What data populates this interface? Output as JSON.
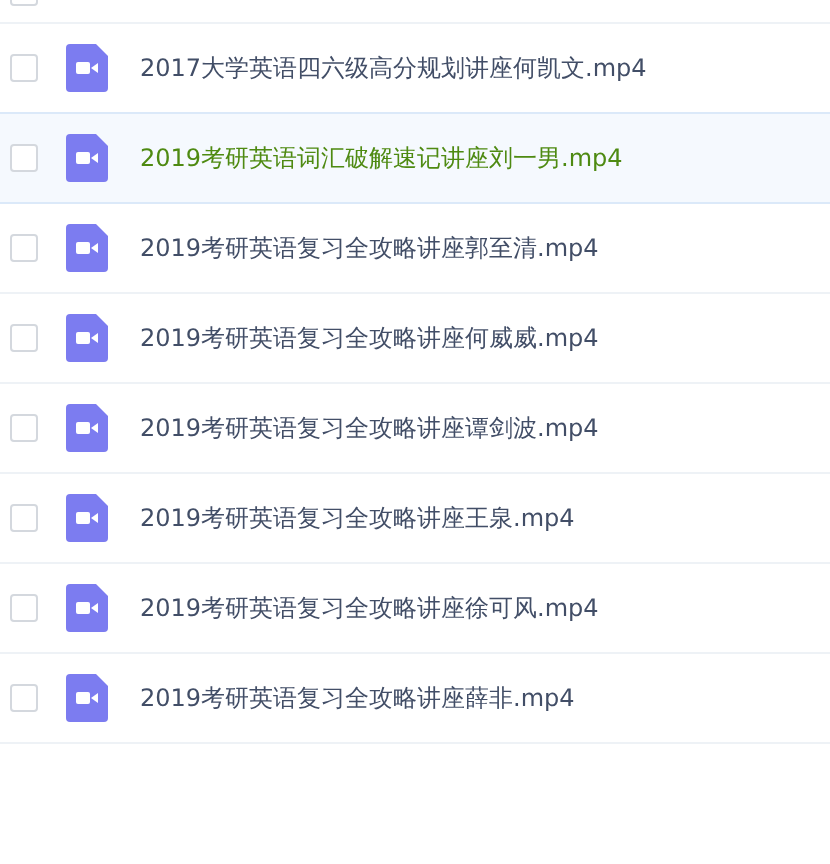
{
  "partial_row": {
    "checked": false
  },
  "files": [
    {
      "name": "2017大学英语四六级高分规划讲座何凯文.mp4",
      "selected": false,
      "checked": false
    },
    {
      "name": "2019考研英语词汇破解速记讲座刘一男.mp4",
      "selected": true,
      "checked": false
    },
    {
      "name": "2019考研英语复习全攻略讲座郭至清.mp4",
      "selected": false,
      "checked": false
    },
    {
      "name": "2019考研英语复习全攻略讲座何威威.mp4",
      "selected": false,
      "checked": false
    },
    {
      "name": "2019考研英语复习全攻略讲座谭剑波.mp4",
      "selected": false,
      "checked": false
    },
    {
      "name": "2019考研英语复习全攻略讲座王泉.mp4",
      "selected": false,
      "checked": false
    },
    {
      "name": "2019考研英语复习全攻略讲座徐可风.mp4",
      "selected": false,
      "checked": false
    },
    {
      "name": "2019考研英语复习全攻略讲座薛非.mp4",
      "selected": false,
      "checked": false
    }
  ]
}
